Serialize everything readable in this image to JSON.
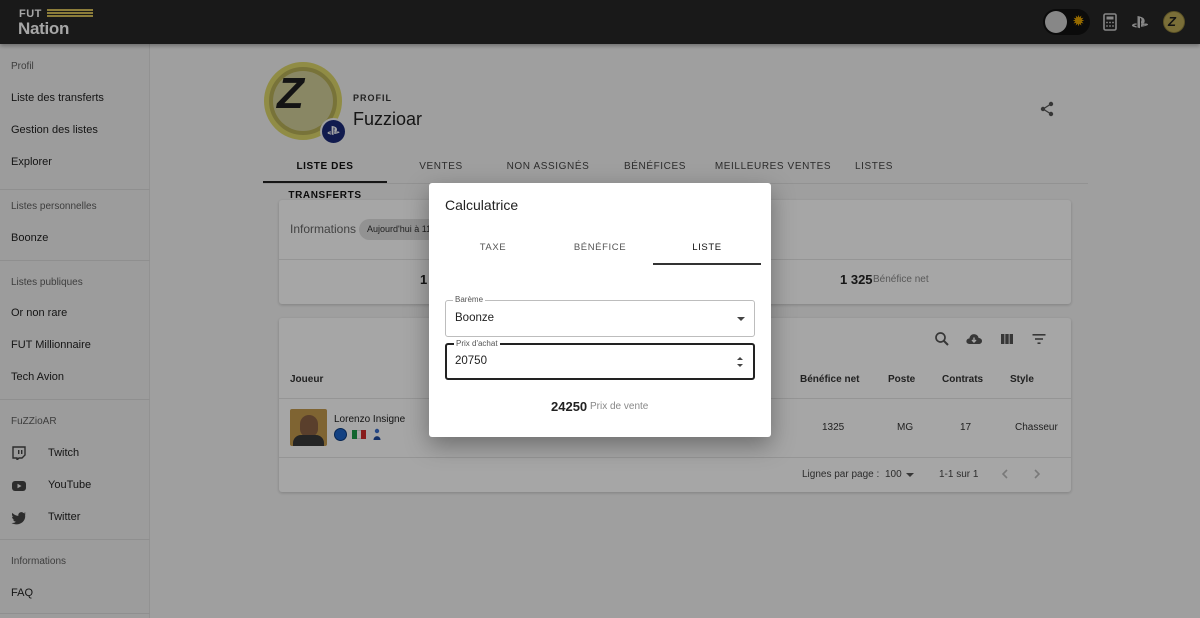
{
  "header": {
    "logo_top": "FUT",
    "logo_bottom": "Nation",
    "icons": [
      "theme-toggle-icon",
      "calculator-icon",
      "playstation-icon",
      "user-avatar"
    ]
  },
  "sidebar": {
    "section_profil": "Profil",
    "item_transferts": "Liste des transferts",
    "item_gestion": "Gestion des listes",
    "item_explorer": "Explorer",
    "section_perso": "Listes personnelles",
    "item_boonze": "Boonze",
    "section_publiques": "Listes publiques",
    "item_or": "Or non rare",
    "item_millionnaire": "FUT Millionnaire",
    "item_tech": "Tech Avion",
    "section_fuzzioar": "FuZZioAR",
    "item_twitch": "Twitch",
    "item_youtube": "YouTube",
    "item_twitter": "Twitter",
    "section_infos": "Informations",
    "item_faq": "FAQ"
  },
  "profile": {
    "label": "PROFIL",
    "name": "Fuzzioar"
  },
  "tabs": [
    "LISTE DES TRANSFERTS",
    "VENTES",
    "NON ASSIGNÉS",
    "BÉNÉFICES",
    "MEILLEURES VENTES",
    "LISTES"
  ],
  "summary": {
    "info_label": "Informations",
    "chip": "Aujourd'hui à 11",
    "stat_left_value": "1",
    "stat_right_value": "1 325",
    "stat_right_label": "Bénéfice net"
  },
  "table": {
    "headers": {
      "joueur": "Joueur",
      "benefice": "Bénéfice net",
      "poste": "Poste",
      "contrats": "Contrats",
      "style": "Style"
    },
    "row": {
      "player": "Lorenzo Insigne",
      "benefice": "1325",
      "poste": "MG",
      "contrats": "17",
      "style": "Chasseur"
    },
    "footer": {
      "rows_label": "Lignes par page :",
      "rows_value": "100",
      "range": "1-1 sur 1"
    }
  },
  "dialog": {
    "title": "Calculatrice",
    "tabs": [
      "TAXE",
      "BÉNÉFICE",
      "LISTE"
    ],
    "active_tab": "LISTE",
    "bareme_label": "Barème",
    "bareme_value": "Boonze",
    "prix_label": "Prix d'achat",
    "prix_value": "20750",
    "result_value": "24250",
    "result_label": "Prix de vente"
  },
  "colors": {
    "topbar": "#272727",
    "accent_gold": "#d8c15a",
    "ps_blue": "#1b2a78"
  }
}
